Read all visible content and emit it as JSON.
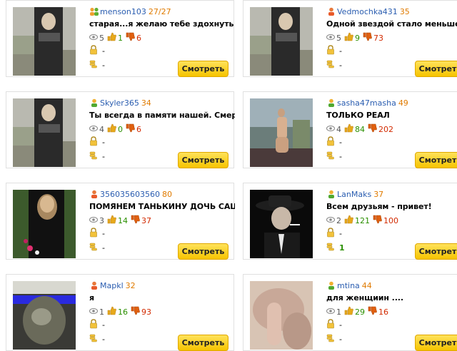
{
  "button_label": "Смотреть",
  "cards": [
    {
      "user": "menson103",
      "rating": "27/27",
      "title": "старая...я желаю тебе здохнуть от все",
      "views": "5",
      "likes": "1",
      "dislikes": "6",
      "row2": "-",
      "row3": "-",
      "thumb": "grave"
    },
    {
      "user": "Vedmochka431",
      "rating": "35",
      "title": "Одной звездой стало меньше на зем",
      "views": "5",
      "likes": "9",
      "dislikes": "73",
      "row2": "-",
      "row3": "-",
      "thumb": "grave"
    },
    {
      "user": "Skyler365",
      "rating": "34",
      "title": "Ты всегда в памяти нашей. Смерть е",
      "views": "4",
      "likes": "0",
      "dislikes": "6",
      "row2": "-",
      "row3": "-",
      "thumb": "grave"
    },
    {
      "user": "sasha47masha",
      "rating": "49",
      "title": "ТОЛЬКО РЕАЛ",
      "views": "4",
      "likes": "84",
      "dislikes": "202",
      "row2": "-",
      "row3": "-",
      "thumb": "room"
    },
    {
      "user": "356035603560",
      "rating": "80",
      "title": "ПОМЯНЕМ ТАНЬКИНУ ДОЧЬ САШКУ...",
      "views": "3",
      "likes": "14",
      "dislikes": "37",
      "row2": "-",
      "row3": "-",
      "thumb": "portrait"
    },
    {
      "user": "LanMaks",
      "rating": "37",
      "title": "Всем друзьям - привет!",
      "views": "2",
      "likes": "121",
      "dislikes": "100",
      "row2": "-",
      "row3": "1",
      "thumb": "hat"
    },
    {
      "user": "Mapkl",
      "rating": "32",
      "title": "я",
      "views": "1",
      "likes": "16",
      "dislikes": "93",
      "row2": "-",
      "row3": "-",
      "thumb": "face"
    },
    {
      "user": "mtina",
      "rating": "44",
      "title": "для женщиин ....",
      "views": "1",
      "likes": "29",
      "dislikes": "16",
      "row2": "-",
      "row3": "-",
      "thumb": "skin"
    }
  ]
}
